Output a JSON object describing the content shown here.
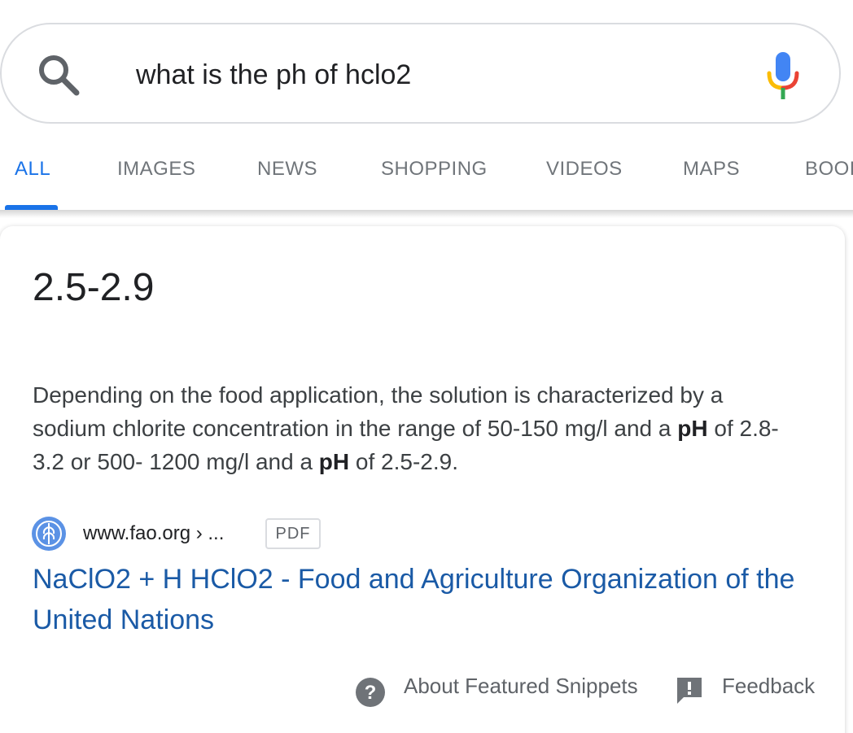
{
  "search": {
    "query": "what is the ph of hclo2",
    "search_icon": "search-icon",
    "mic_icon": "microphone-icon"
  },
  "tabs": [
    {
      "label": "ALL",
      "active": true
    },
    {
      "label": "IMAGES",
      "active": false
    },
    {
      "label": "NEWS",
      "active": false
    },
    {
      "label": "SHOPPING",
      "active": false
    },
    {
      "label": "VIDEOS",
      "active": false
    },
    {
      "label": "MAPS",
      "active": false
    },
    {
      "label": "BOOK",
      "active": false
    }
  ],
  "featured_snippet": {
    "answer": "2.5-2.9",
    "text_part1": "Depending on the food application, the solution is characterized by a sodium chlorite concentration in the range of 50-150 mg/l and a ",
    "bold1": "pH",
    "text_part2": " of 2.8-3.2 or 500- 1200 mg/l and a ",
    "bold2": "pH",
    "text_part3": " of 2.5-2.9.",
    "source_url": "www.fao.org › ...",
    "file_type": "PDF",
    "favicon": "fao-logo-icon",
    "result_title": "NaClO2 + H HClO2 - Food and Agriculture Organization of the United Nations"
  },
  "footer": {
    "about_label": "About Featured Snippets",
    "feedback_label": "Feedback",
    "help_icon": "help-icon",
    "feedback_icon": "feedback-icon"
  },
  "colors": {
    "accent": "#1a73e8",
    "link": "#1a5aa6",
    "muted": "#70757a"
  }
}
